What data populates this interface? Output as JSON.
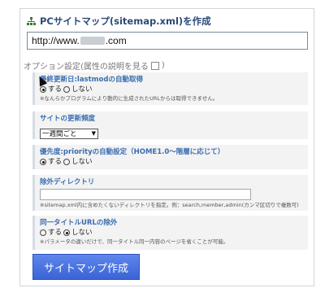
{
  "header": {
    "title": "PCサイトマップ(sitemap.xml)を作成"
  },
  "url": {
    "prefix": "http://www.",
    "suffix": ".com"
  },
  "options_link": "オプション設定(属性の説明を見る",
  "lastmod": {
    "label": "最終更新日:lastmodの自動取得",
    "on_label": "する",
    "off_label": "しない",
    "selected": "on",
    "note": "※なんらかプログラムにより動的に生成されたURLからは取得できません。"
  },
  "changefreq": {
    "label": "サイトの更新頻度",
    "selected": "一週間ごと"
  },
  "priority": {
    "label": "優先度:priorityの自動設定（HOME1.0～階層に応じて）",
    "on_label": "する",
    "off_label": "しない",
    "selected": "on"
  },
  "exclude_dir": {
    "label": "除外ディレクトリ",
    "value": "",
    "note": "※sitemap.xml内に含めたくないディレクトリを指定。例：search,member,admin(カンマ区切りで複数可)"
  },
  "dup_title": {
    "label": "同一タイトルURLの除外",
    "on_label": "する",
    "off_label": "しない",
    "selected": "off",
    "note": "※パラメータの違いだけで、同一タイトル同一内容のページを省くことが可能。"
  },
  "submit_label": "サイトマップ作成",
  "colors": {
    "accent": "#3a63d6",
    "label": "#3a6db0",
    "title": "#2c4a78"
  }
}
